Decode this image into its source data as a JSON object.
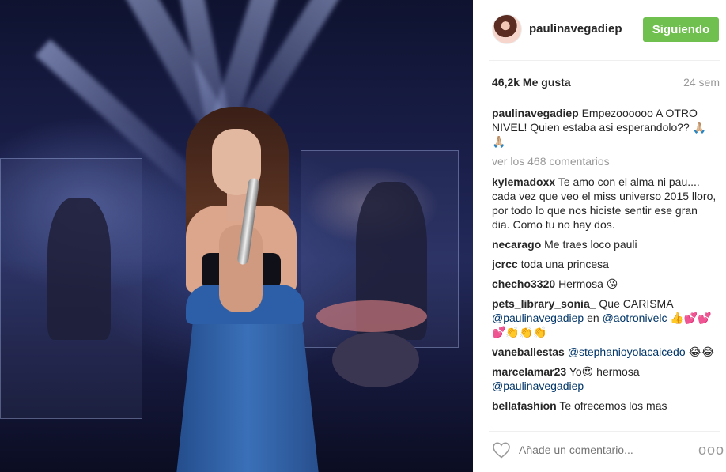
{
  "post": {
    "username": "paulinavegadiep",
    "follow_label": "Siguiendo",
    "likes": "46,2k Me gusta",
    "time": "24 sem",
    "caption": {
      "user": "paulinavegadiep",
      "text": "Empezoooooo A OTRO NIVEL! Quien estaba asi esperandolo?? 🙏🏼🙏🏼"
    },
    "view_all": "ver los 468 comentarios",
    "comments": [
      {
        "user": "kylemadoxx",
        "text": "Te amo con el alma ni pau.... cada vez que veo el miss universo 2015 lloro, por todo lo que nos hiciste sentir ese gran dia. Como tu no hay dos."
      },
      {
        "user": "necarago",
        "text": "Me traes loco pauli"
      },
      {
        "user": "jcrcc",
        "text": "toda una princesa"
      },
      {
        "user": "checho3320",
        "text": "Hermosa 😘"
      },
      {
        "user": "pets_library_sonia_",
        "text": "Que CARISMA",
        "mention1": "@paulinavegadiep",
        "mid": "en",
        "mention2": "@aotronivelc",
        "tail": "👍💕💕💕👏👏👏"
      },
      {
        "user": "vaneballestas",
        "mention": "@stephanioyolacaicedo",
        "text": "😂😂"
      },
      {
        "user": "marcelamar23",
        "text": "Yo😍 hermosa",
        "mention": "@paulinavegadiep"
      },
      {
        "user": "bellafashion",
        "text": "Te ofrecemos los mas"
      }
    ],
    "add_comment_placeholder": "Añade un comentario...",
    "more_label": "ooo"
  },
  "icons": {
    "heart": "heart-outline-icon",
    "more": "more-options-icon"
  },
  "colors": {
    "follow": "#70c050",
    "mention": "#003569",
    "muted": "#999999"
  }
}
